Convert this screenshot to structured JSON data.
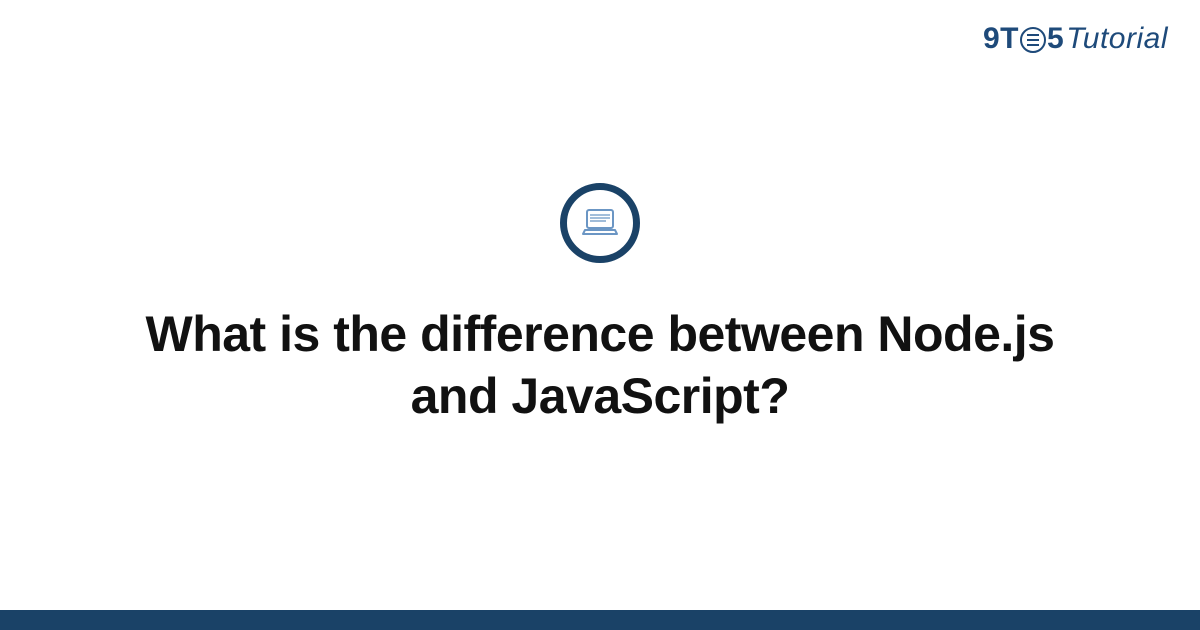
{
  "logo": {
    "part1": "9T",
    "part2": "5",
    "part3": "Tutorial"
  },
  "title": "What is the difference between Node.js and JavaScript?",
  "colors": {
    "brand": "#1e4a7a",
    "footer": "#1a4267"
  }
}
